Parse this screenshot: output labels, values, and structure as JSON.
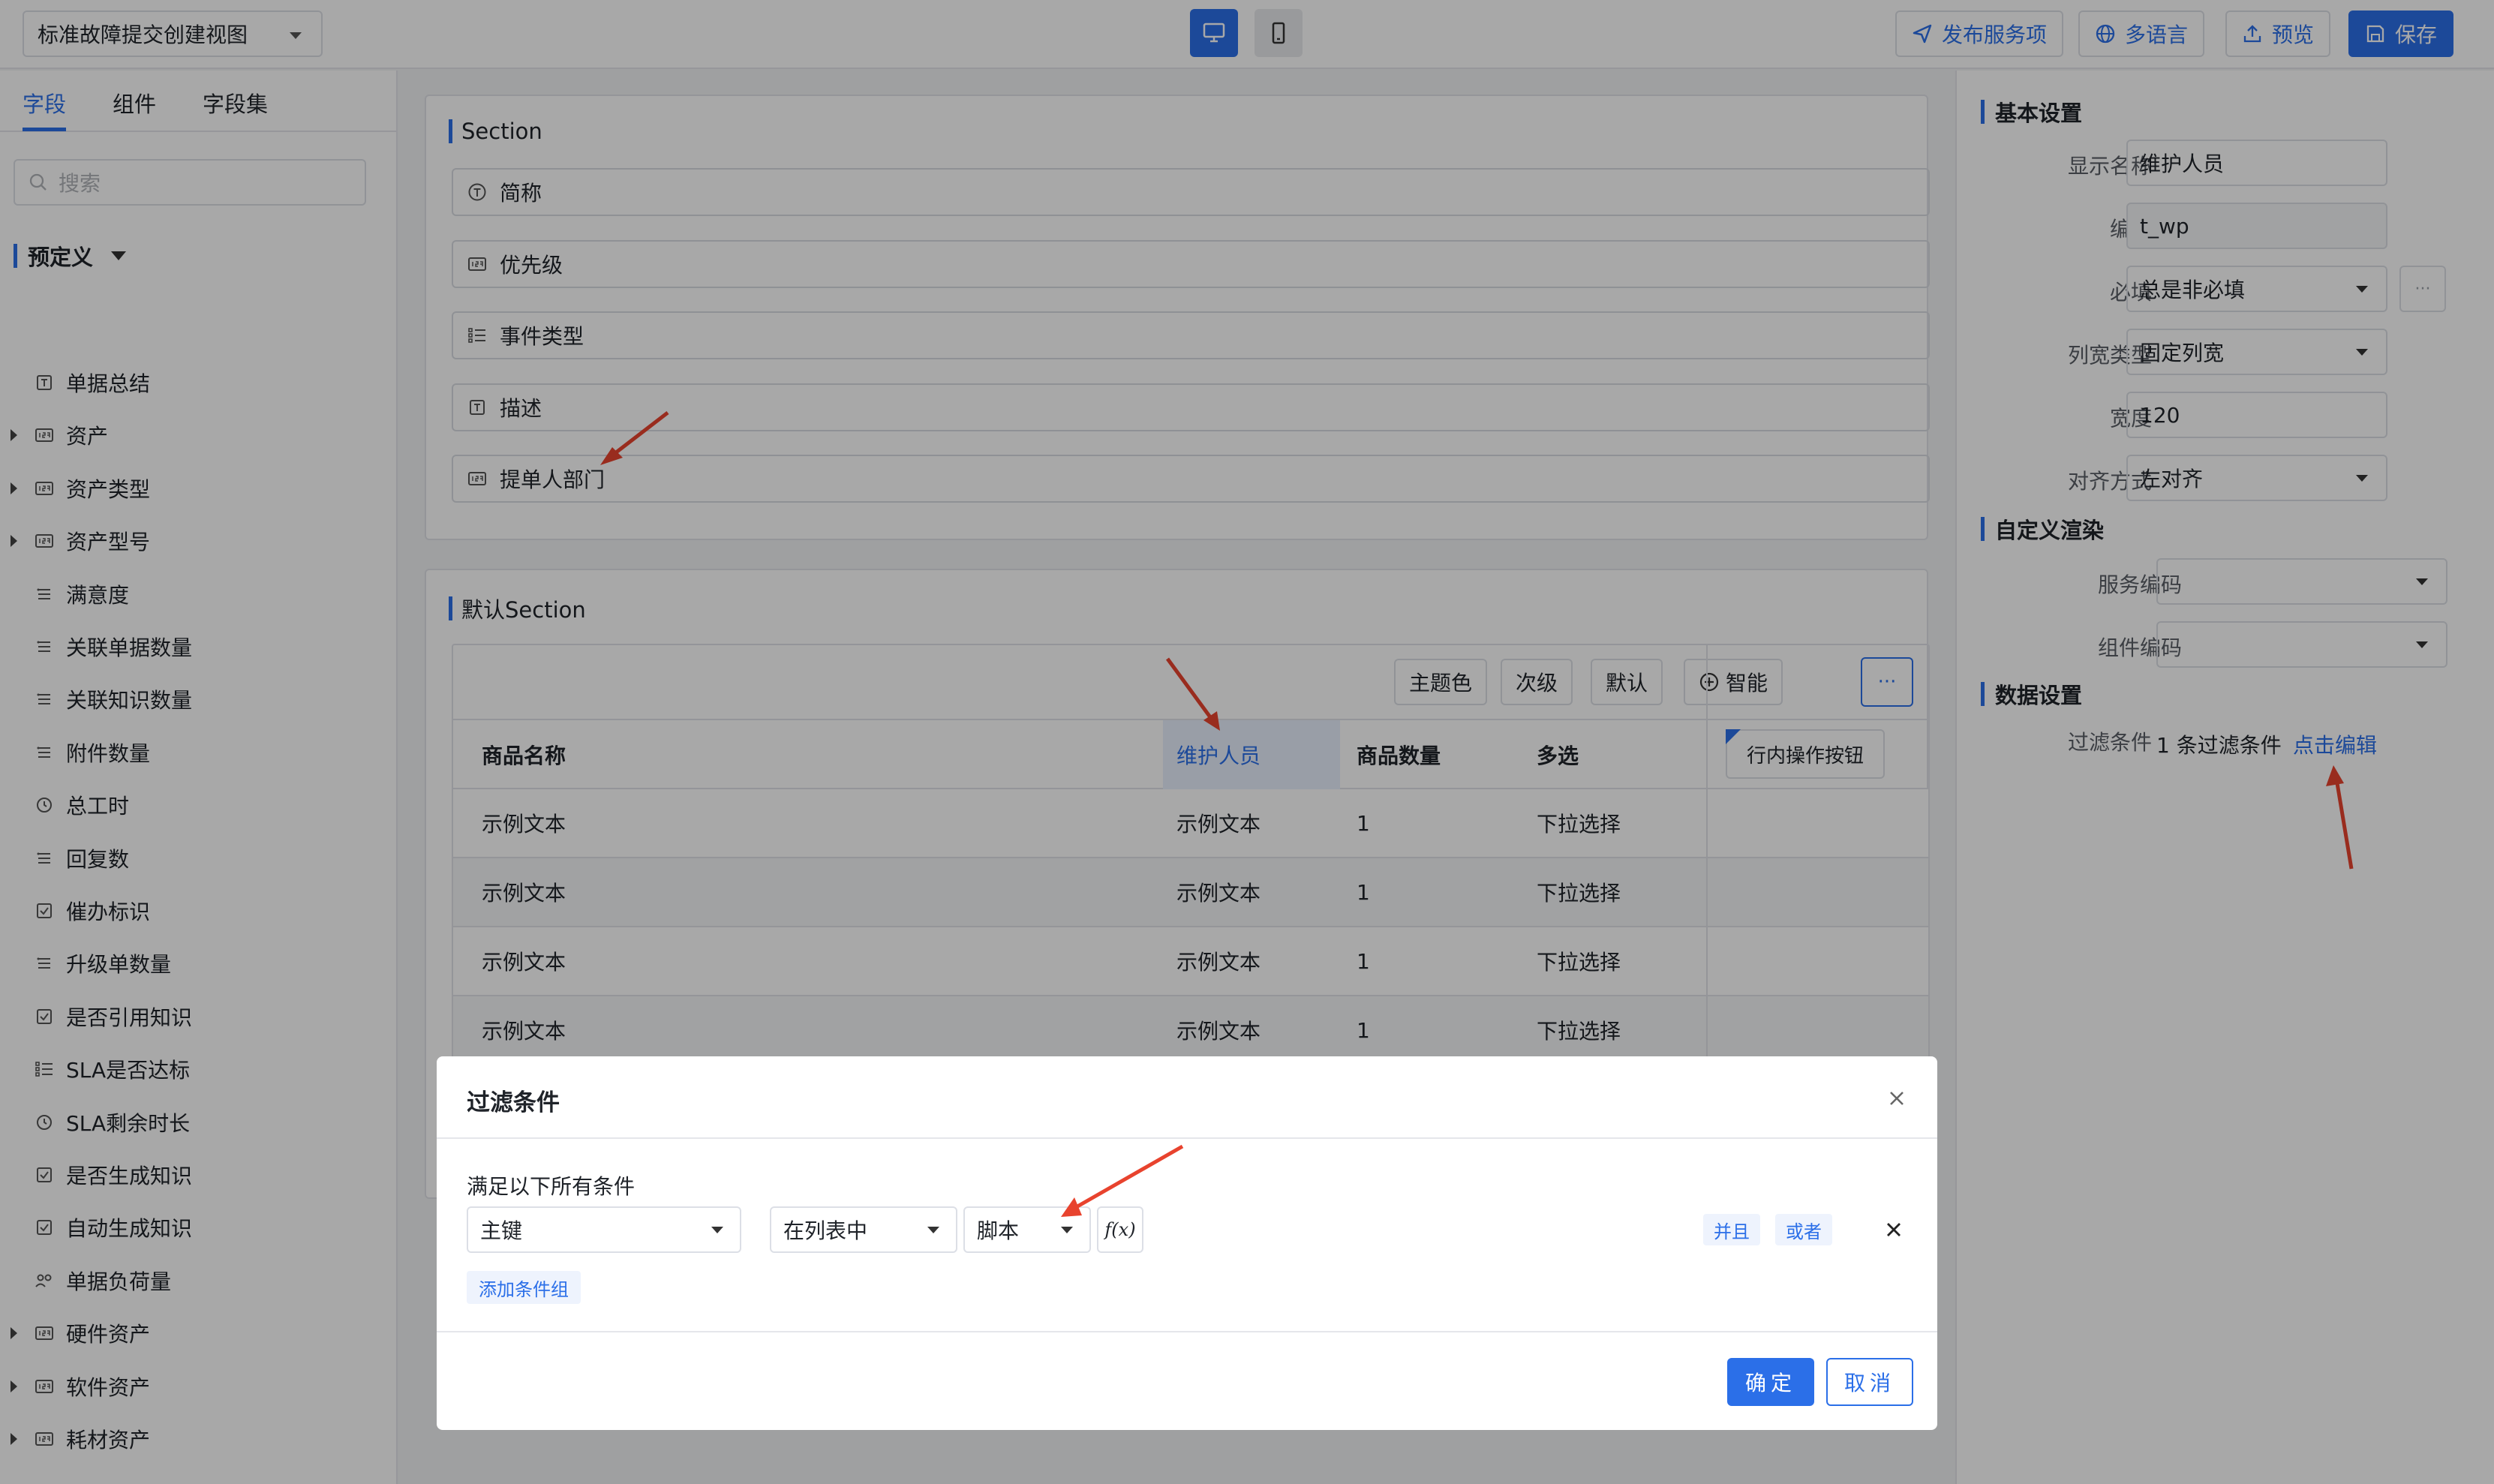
{
  "header": {
    "view_select": "标准故障提交创建视图",
    "publish_label": "发布服务项",
    "i18n_label": "多语言",
    "preview_label": "预览",
    "save_label": "保存"
  },
  "left": {
    "tabs": [
      "字段",
      "组件",
      "字段集"
    ],
    "search_placeholder": "搜索",
    "group_label": "预定义",
    "fields": [
      {
        "label": "单据总结",
        "icon": "text-field-icon",
        "expandable": false
      },
      {
        "label": "资产",
        "icon": "number-field-icon",
        "expandable": true
      },
      {
        "label": "资产类型",
        "icon": "number-field-icon",
        "expandable": true
      },
      {
        "label": "资产型号",
        "icon": "number-field-icon",
        "expandable": true
      },
      {
        "label": "满意度",
        "icon": "list-icon",
        "expandable": false
      },
      {
        "label": "关联单据数量",
        "icon": "list-icon",
        "expandable": false
      },
      {
        "label": "关联知识数量",
        "icon": "list-icon",
        "expandable": false
      },
      {
        "label": "附件数量",
        "icon": "list-icon",
        "expandable": false
      },
      {
        "label": "总工时",
        "icon": "clock-icon",
        "expandable": false
      },
      {
        "label": "回复数",
        "icon": "list-icon",
        "expandable": false
      },
      {
        "label": "催办标识",
        "icon": "checkbox-icon",
        "expandable": false
      },
      {
        "label": "升级单数量",
        "icon": "list-icon",
        "expandable": false
      },
      {
        "label": "是否引用知识",
        "icon": "checkbox-icon",
        "expandable": false
      },
      {
        "label": "SLA是否达标",
        "icon": "checklist-icon",
        "expandable": false
      },
      {
        "label": "SLA剩余时长",
        "icon": "clock-icon",
        "expandable": false
      },
      {
        "label": "是否生成知识",
        "icon": "checkbox-icon",
        "expandable": false
      },
      {
        "label": "自动生成知识",
        "icon": "checkbox-icon",
        "expandable": false
      },
      {
        "label": "单据负荷量",
        "icon": "users-icon",
        "expandable": false
      },
      {
        "label": "硬件资产",
        "icon": "number-field-icon",
        "expandable": true
      },
      {
        "label": "软件资产",
        "icon": "number-field-icon",
        "expandable": true
      },
      {
        "label": "耗材资产",
        "icon": "number-field-icon",
        "expandable": true
      }
    ]
  },
  "canvas": {
    "section1": {
      "title": "Section",
      "fields": [
        {
          "label": "简称",
          "icon": "text-circle-icon"
        },
        {
          "label": "优先级",
          "icon": "number-field-icon"
        },
        {
          "label": "事件类型",
          "icon": "checklist-icon"
        },
        {
          "label": "描述",
          "icon": "text-field-icon"
        },
        {
          "label": "提单人部门",
          "icon": "number-field-icon"
        }
      ]
    },
    "section2": {
      "title": "默认Section",
      "toolbar": [
        "主题色",
        "次级",
        "默认",
        "智能"
      ],
      "more_label": "···",
      "columns": [
        "商品名称",
        "维护人员",
        "商品数量",
        "多选"
      ],
      "action_column": "行内操作按钮",
      "rows": [
        [
          "示例文本",
          "示例文本",
          "1",
          "下拉选择"
        ],
        [
          "示例文本",
          "示例文本",
          "1",
          "下拉选择"
        ],
        [
          "示例文本",
          "示例文本",
          "1",
          "下拉选择"
        ],
        [
          "示例文本",
          "示例文本",
          "1",
          "下拉选择"
        ]
      ]
    }
  },
  "right": {
    "basic_title": "基本设置",
    "display_name_label": "显示名称",
    "display_name": "维护人员",
    "code_label": "编码",
    "code": "t_wp",
    "required_label": "必填",
    "required": "总是非必填",
    "required_more": "···",
    "col_width_type_label": "列宽类型",
    "col_width_type": "固定列宽",
    "width_label": "宽度",
    "width": "120",
    "align_label": "对齐方式",
    "align": "左对齐",
    "render_title": "自定义渲染",
    "service_code_label": "服务编码",
    "component_code_label": "组件编码",
    "data_title": "数据设置",
    "filter_label": "过滤条件",
    "filter_summary": "1 条过滤条件",
    "filter_edit": "点击编辑"
  },
  "modal": {
    "title": "过滤条件",
    "hint": "满足以下所有条件",
    "field": "主键",
    "operator": "在列表中",
    "value_type": "脚本",
    "fx_label": "f(x)",
    "and_label": "并且",
    "or_label": "或者",
    "add_group_label": "添加条件组",
    "ok_label": "确定",
    "cancel_label": "取消"
  },
  "colors": {
    "accent": "#2b6fe8",
    "annotation_arrow": "#e8432e"
  }
}
